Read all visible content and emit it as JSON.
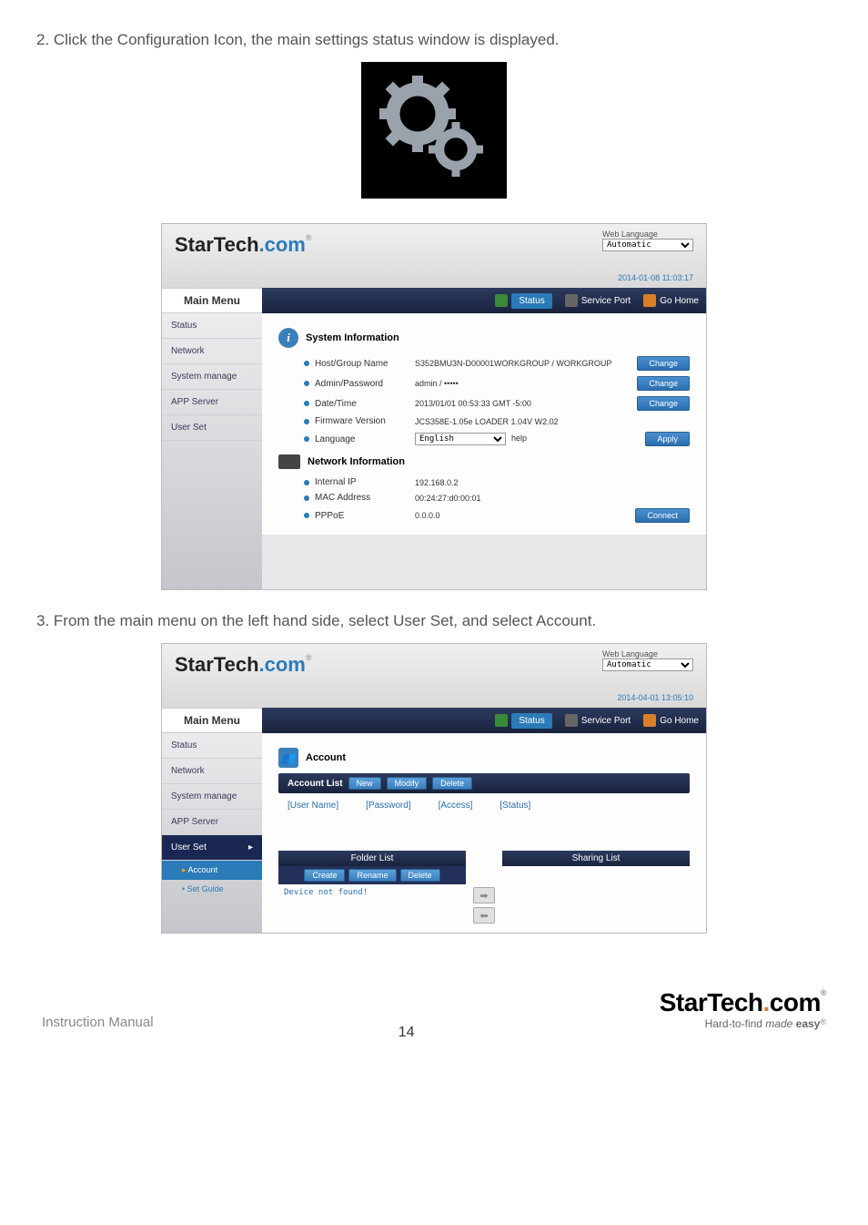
{
  "instructions": {
    "step2": "2.  Click the Configuration Icon, the main settings status window is displayed.",
    "step3": "3.  From the main menu on the left hand side, select User Set, and select Account."
  },
  "logo": {
    "part1": "StarTech",
    "part2": ".com",
    "tm": "®"
  },
  "footer": {
    "left": "Instruction Manual",
    "page": "14",
    "tagline1": "Hard-to-find ",
    "tagline2_em": "made ",
    "tagline2_b": "easy",
    "tm": "®"
  },
  "ss1": {
    "lang_label": "Web Language",
    "lang_value": "Automatic",
    "timestamp": "2014-01-08 11:03:17",
    "mainmenu_hdr": "Main Menu",
    "menu": [
      "Status",
      "Network",
      "System manage",
      "APP Server",
      "User Set"
    ],
    "tabs": {
      "status": "Status",
      "service": "Service Port",
      "home": "Go Home"
    },
    "sect_sysinfo": "System Information",
    "sect_netinfo": "Network Information",
    "rows": {
      "host_lbl": "Host/Group Name",
      "host_val": "S352BMU3N-D00001WORKGROUP / WORKGROUP",
      "admin_lbl": "Admin/Password",
      "admin_val": "admin / •••••",
      "date_lbl": "Date/Time",
      "date_val": "2013/01/01 00:53:33 GMT -5:00",
      "fw_lbl": "Firmware Version",
      "fw_val": "JCS358E-1.05e LOADER 1.04V W2.02",
      "lang_lbl": "Language",
      "lang_val": "English",
      "lang_help": "help",
      "ip_lbl": "Internal IP",
      "ip_val": "192.168.0.2",
      "mac_lbl": "MAC Address",
      "mac_val": "00:24:27:d0:00:01",
      "pppoe_lbl": "PPPoE",
      "pppoe_val": "0.0.0.0"
    },
    "buttons": {
      "change": "Change",
      "apply": "Apply",
      "connect": "Connect"
    }
  },
  "ss2": {
    "lang_label": "Web Language",
    "lang_value": "Automatic",
    "timestamp": "2014-04-01 13:05:10",
    "mainmenu_hdr": "Main Menu",
    "menu": [
      "Status",
      "Network",
      "System manage",
      "APP Server"
    ],
    "menu_active": "User Set",
    "submenu": {
      "account": "Account",
      "setguide": "Set Guide"
    },
    "tabs": {
      "status": "Status",
      "service": "Service Port",
      "home": "Go Home"
    },
    "sect_account": "Account",
    "account_bar": {
      "title": "Account List",
      "new": "New",
      "modify": "Modify",
      "delete": "Delete"
    },
    "tbl_cols": {
      "user": "[User Name]",
      "pass": "[Password]",
      "access": "[Access]",
      "status": "[Status]"
    },
    "folder_bar": {
      "title": "Folder List",
      "create": "Create",
      "rename": "Rename",
      "delete": "Delete"
    },
    "folder_msg": "Device not found!",
    "sharing_bar": {
      "title": "Sharing List"
    },
    "arrows": {
      "right": "➡",
      "left": "⬅"
    }
  }
}
